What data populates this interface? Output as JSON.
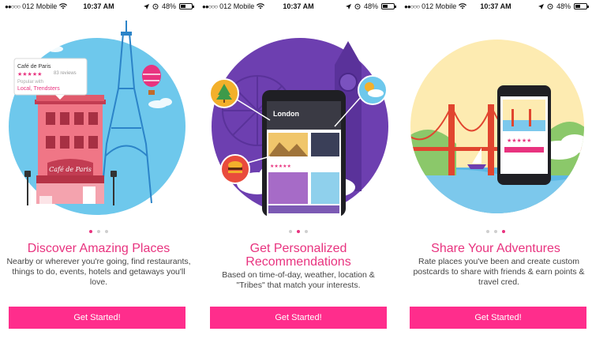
{
  "status_bar": {
    "carrier": "012 Mobile",
    "signal_dots": "●●○○○",
    "time": "10:37 AM",
    "battery_percent": "48%",
    "battery_level": 0.48,
    "icons": [
      "wifi-icon",
      "location-arrow-icon",
      "alarm-icon",
      "battery-icon"
    ]
  },
  "colors": {
    "accent": "#e8337f",
    "button": "#ff2d8c",
    "dot_inactive": "#cfcfcf"
  },
  "screens": [
    {
      "title": "Discover Amazing Places",
      "description": "Nearby or wherever you're going, find restaurants, things to do, events, hotels and getaways you'll love.",
      "page_index": 0,
      "button_label": "Get Started!",
      "card": {
        "place_name": "Café de Paris",
        "reviews": "83 reviews",
        "stars": "★★★★★",
        "popular_with": "Popular with",
        "tribes": "Local, Trendsters"
      },
      "sign_text": "Café de Paris"
    },
    {
      "title": "Get Personalized Recommendations",
      "description": "Based on time-of-day, weather, location & \"Tribes\" that match your interests.",
      "page_index": 1,
      "button_label": "Get Started!",
      "phone_city": "London"
    },
    {
      "title": "Share Your Adventures",
      "description": "Rate places you've been and create custom postcards to share with friends & earn points & travel cred.",
      "page_index": 2,
      "button_label": "Get Started!"
    }
  ]
}
